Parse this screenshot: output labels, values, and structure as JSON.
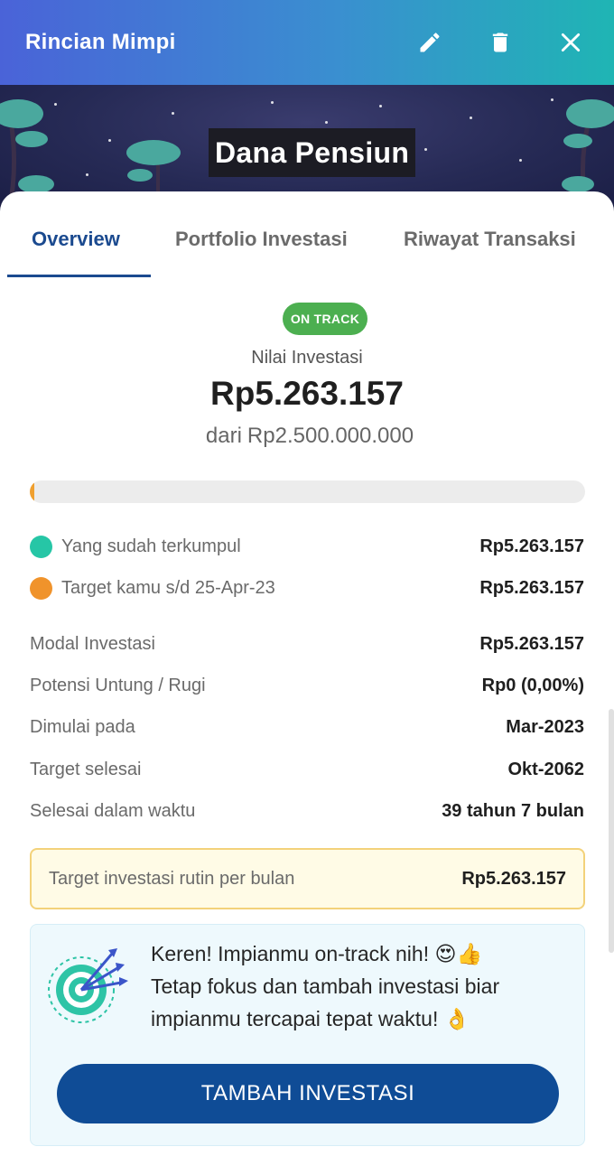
{
  "header": {
    "title": "Rincian Mimpi",
    "edit_icon": "pencil-icon",
    "delete_icon": "trash-icon",
    "close_icon": "close-icon",
    "gradient_start": "#4a63d8",
    "gradient_end": "#1fb5b4"
  },
  "hero": {
    "goal_name": "Dana Pensiun"
  },
  "tabs": [
    {
      "label": "Overview",
      "active": true
    },
    {
      "label": "Portfolio Investasi",
      "active": false
    },
    {
      "label": "Riwayat Transaksi",
      "active": false
    }
  ],
  "overview": {
    "status_badge": "ON TRACK",
    "status_color": "#4caf50",
    "investment_label": "Nilai Investasi",
    "investment_value": "Rp5.263.157",
    "target_prefix": "dari",
    "target_value": "Rp2.500.000.000",
    "progress_fraction": 0.0021,
    "legend": [
      {
        "label": "Yang sudah terkumpul",
        "value": "Rp5.263.157",
        "color": "#26c6a6"
      },
      {
        "label": "Target kamu s/d 25-Apr-23",
        "value": "Rp5.263.157",
        "color": "#f0932b"
      }
    ],
    "details": [
      {
        "label": "Modal Investasi",
        "value": "Rp5.263.157"
      },
      {
        "label": "Potensi Untung / Rugi",
        "value": "Rp0 (0,00%)"
      },
      {
        "label": "Dimulai pada",
        "value": "Mar-2023"
      },
      {
        "label": "Target selesai",
        "value": "Okt-2062"
      },
      {
        "label": "Selesai dalam waktu",
        "value": "39 tahun 7 bulan"
      }
    ],
    "monthly_target": {
      "label": "Target investasi rutin per bulan",
      "value": "Rp5.263.157"
    },
    "message": {
      "icon": "target-arrows-icon",
      "line1": "Keren! Impianmu on-track nih! 😍👍",
      "line2": "Tetap fokus dan tambah investasi biar",
      "line3": "impianmu tercapai tepat waktu! 👌"
    },
    "cta_label": "TAMBAH INVESTASI"
  }
}
